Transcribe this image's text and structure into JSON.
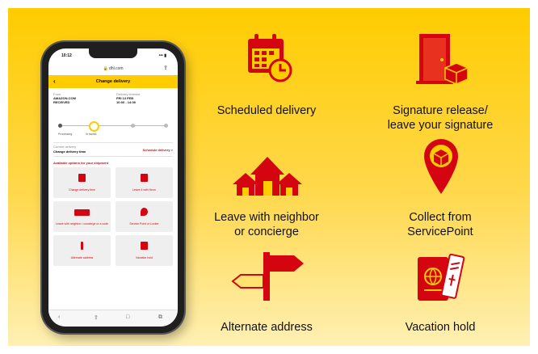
{
  "phone": {
    "status_time": "10:12",
    "status_signal": "••• ▮",
    "url": "🔒 dhl.com",
    "share_icon": "share-icon",
    "header_title": "Change delivery",
    "back_symbol": "‹",
    "from_label": "From",
    "from_value": "AMAZON.COM",
    "from_sub": "RECEIVED",
    "delivery_label": "Delivery timeslot",
    "delivery_value": "FRI 13 FEB",
    "delivery_sub": "10:00 - 14:00",
    "progress_labels": [
      "Processing",
      "In transit"
    ],
    "current_delivery_label": "Current delivery",
    "current_delivery_value": "Change delivery time",
    "current_delivery_link": "Schedule delivery >",
    "available_label": "Available options for your shipment",
    "tiles": [
      "Change delivery time",
      "Leave it with Neon",
      "Leave with neighbor / concierge or a code",
      "Service Point or Locker",
      "Alternate address",
      "Vacation hold"
    ],
    "nav": [
      "‹",
      "⇪",
      "□",
      "⧉"
    ]
  },
  "features": [
    {
      "icon": "calendar-clock-icon",
      "label": "Scheduled delivery"
    },
    {
      "icon": "door-parcel-icon",
      "label": "Signature release/\nleave your signature"
    },
    {
      "icon": "houses-icon",
      "label": "Leave with neighbor\nor concierge"
    },
    {
      "icon": "location-pin-parcel-icon",
      "label": "Collect from\nServicePoint"
    },
    {
      "icon": "signpost-icon",
      "label": "Alternate address"
    },
    {
      "icon": "passport-ticket-icon",
      "label": "Vacation hold"
    }
  ],
  "colors": {
    "accent": "#D40511",
    "brand_yellow": "#FFCC00"
  }
}
